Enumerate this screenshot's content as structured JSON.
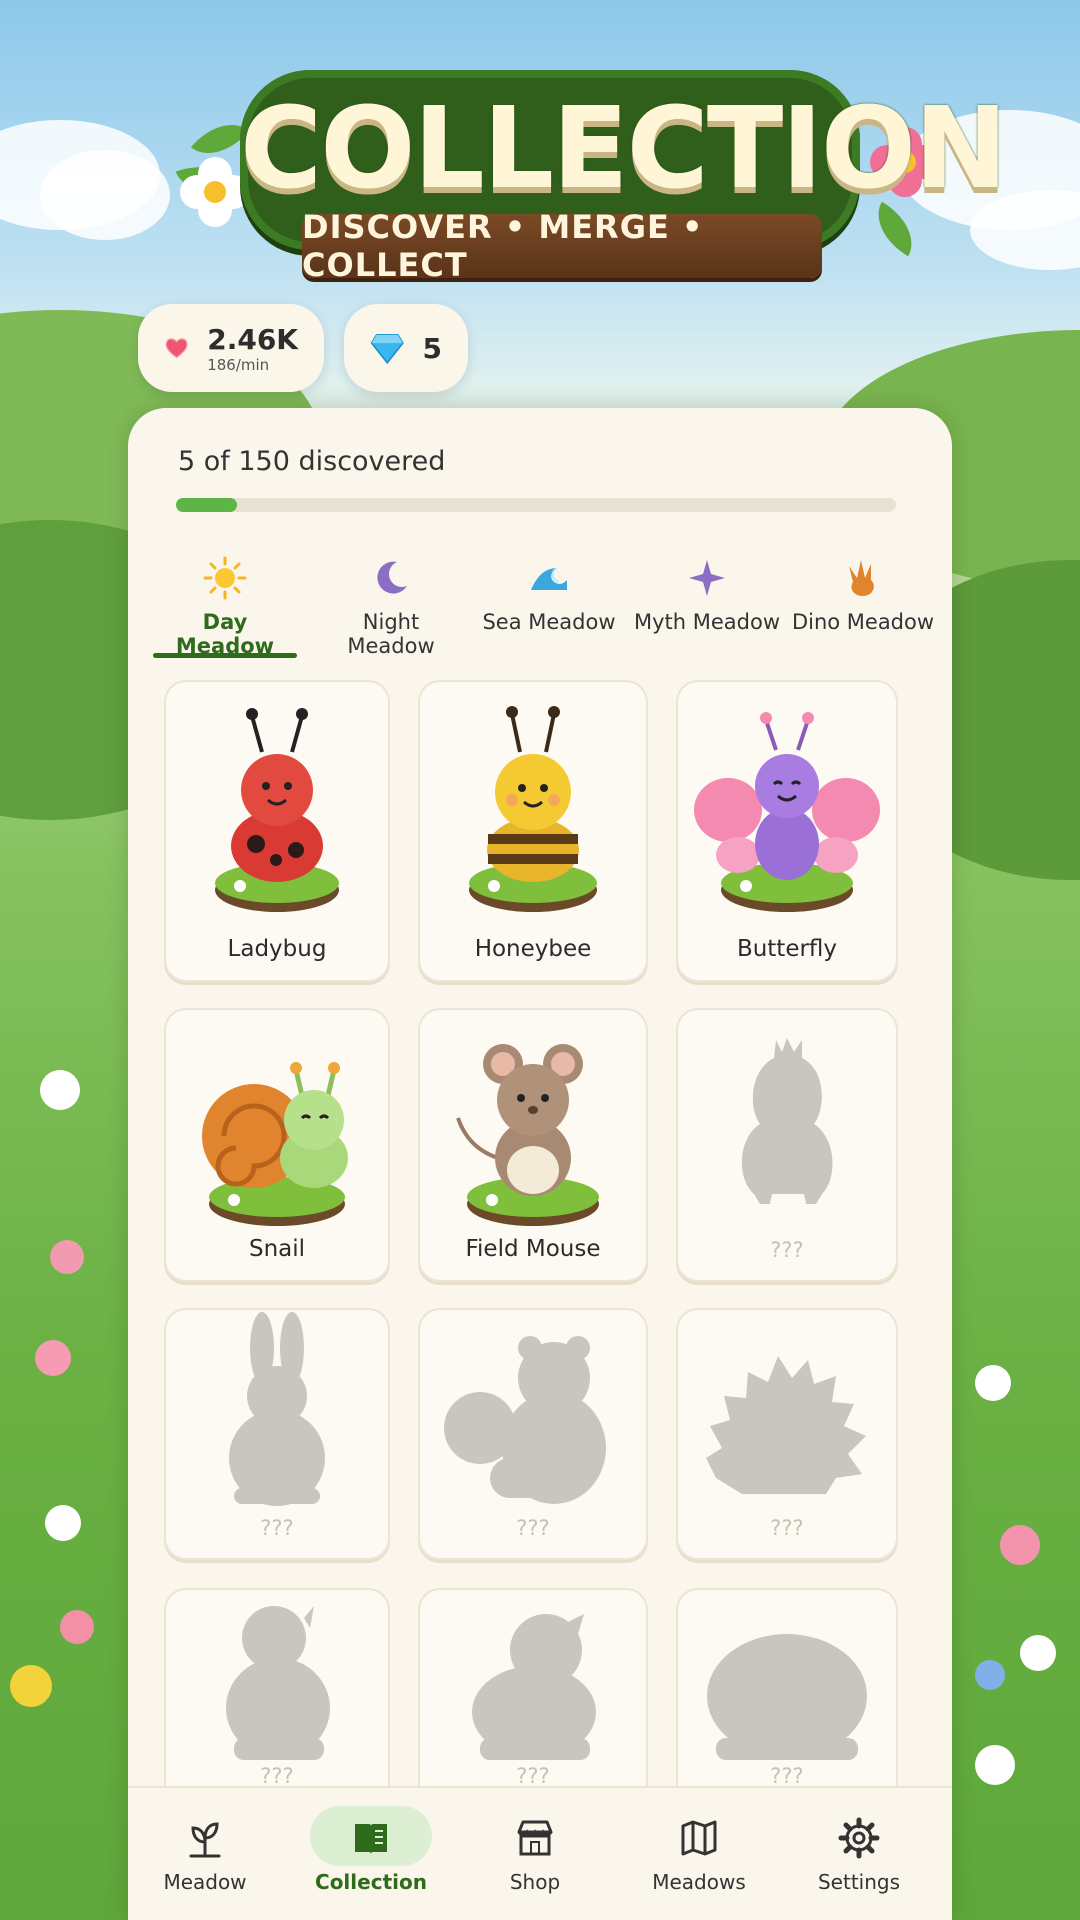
{
  "header": {
    "title": "COLLECTION",
    "subtitle": "DISCOVER • MERGE • COLLECT"
  },
  "currency": {
    "hearts": {
      "amount": "2.46K",
      "rate": "186/min",
      "icon": "heart-icon",
      "color": "#ef4f6a"
    },
    "gems": {
      "amount": "5",
      "icon": "diamond-icon",
      "color": "#3ab6ee"
    }
  },
  "progress": {
    "label": "5 of 150 discovered",
    "discovered": 5,
    "total": 150,
    "fill_color": "#5cb545"
  },
  "tabs": [
    {
      "label": "Day Meadow",
      "icon": "sun-icon",
      "active": true
    },
    {
      "label": "Night Meadow",
      "icon": "moon-icon",
      "active": false
    },
    {
      "label": "Sea Meadow",
      "icon": "wave-icon",
      "active": false
    },
    {
      "label": "Myth Meadow",
      "icon": "sparkle-icon",
      "active": false
    },
    {
      "label": "Dino Meadow",
      "icon": "footprint-icon",
      "active": false
    }
  ],
  "creatures": [
    {
      "name": "Ladybug",
      "discovered": true
    },
    {
      "name": "Honeybee",
      "discovered": true
    },
    {
      "name": "Butterfly",
      "discovered": true
    },
    {
      "name": "Snail",
      "discovered": true
    },
    {
      "name": "Field Mouse",
      "discovered": true
    },
    {
      "name": "???",
      "discovered": false
    },
    {
      "name": "???",
      "discovered": false
    },
    {
      "name": "???",
      "discovered": false
    },
    {
      "name": "???",
      "discovered": false
    },
    {
      "name": "???",
      "discovered": false
    },
    {
      "name": "???",
      "discovered": false
    },
    {
      "name": "???",
      "discovered": false
    }
  ],
  "nav": [
    {
      "label": "Meadow",
      "icon": "sprout-icon",
      "active": false
    },
    {
      "label": "Collection",
      "icon": "book-icon",
      "active": true
    },
    {
      "label": "Shop",
      "icon": "shop-icon",
      "active": false
    },
    {
      "label": "Meadows",
      "icon": "map-icon",
      "active": false
    },
    {
      "label": "Settings",
      "icon": "gear-icon",
      "active": false
    }
  ],
  "colors": {
    "accent": "#2e6b1c",
    "panel": "#fbf6ec",
    "silhouette": "#c9c6c0"
  }
}
